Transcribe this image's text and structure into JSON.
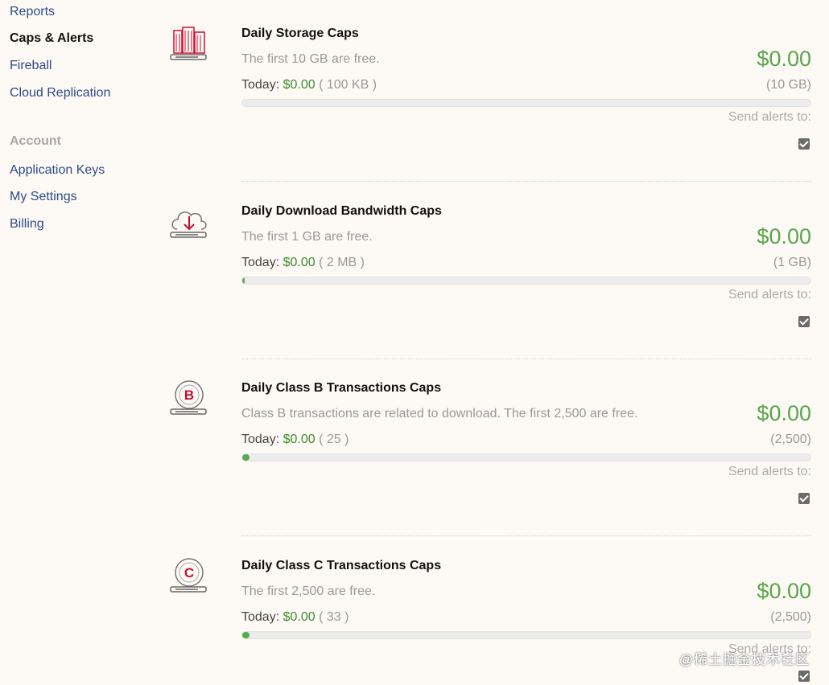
{
  "sidebar": {
    "items_top": [
      {
        "label": "Reports",
        "active": false
      },
      {
        "label": "Caps & Alerts",
        "active": true
      },
      {
        "label": "Fireball",
        "active": false
      },
      {
        "label": "Cloud Replication",
        "active": false
      }
    ],
    "account_heading": "Account",
    "items_account": [
      {
        "label": "Application Keys"
      },
      {
        "label": "My Settings"
      },
      {
        "label": "Billing"
      }
    ]
  },
  "caps": [
    {
      "icon": "storage-building-icon",
      "title": "Daily Storage Caps",
      "description": "The first 10 GB are free.",
      "amount": "$0.00",
      "today_label": "Today:",
      "today_value": "$0.00",
      "today_usage": "( 100 KB )",
      "limit": "(10 GB)",
      "progress": 0,
      "alerts_label": "Send alerts to:",
      "alert_email": "",
      "alert_checked": true
    },
    {
      "icon": "cloud-download-icon",
      "title": "Daily Download Bandwidth Caps",
      "description": "The first 1 GB are free.",
      "amount": "$0.00",
      "today_label": "Today:",
      "today_value": "$0.00",
      "today_usage": "( 2 MB )",
      "limit": "(1 GB)",
      "progress": 0.002,
      "alerts_label": "Send alerts to:",
      "alert_email": "",
      "alert_checked": true
    },
    {
      "icon": "class-b-icon",
      "title": "Daily Class B Transactions Caps",
      "description": "Class B transactions are related to download. The first 2,500 are free.",
      "amount": "$0.00",
      "today_label": "Today:",
      "today_value": "$0.00",
      "today_usage": "( 25 )",
      "limit": "(2,500)",
      "progress": 0.01,
      "alerts_label": "Send alerts to:",
      "alert_email": "",
      "alert_checked": true
    },
    {
      "icon": "class-c-icon",
      "title": "Daily Class C Transactions Caps",
      "description": "The first 2,500 are free.",
      "amount": "$0.00",
      "today_label": "Today:",
      "today_value": "$0.00",
      "today_usage": "( 33 )",
      "limit": "(2,500)",
      "progress": 0.013,
      "alerts_label": "Send alerts to:",
      "alert_email": "",
      "alert_checked": true
    }
  ],
  "watermark": "@稀土掘金技术社区",
  "colors": {
    "accent_green": "#5aa64a",
    "link_blue": "#2e4a85",
    "brand_red": "#c8102e"
  }
}
